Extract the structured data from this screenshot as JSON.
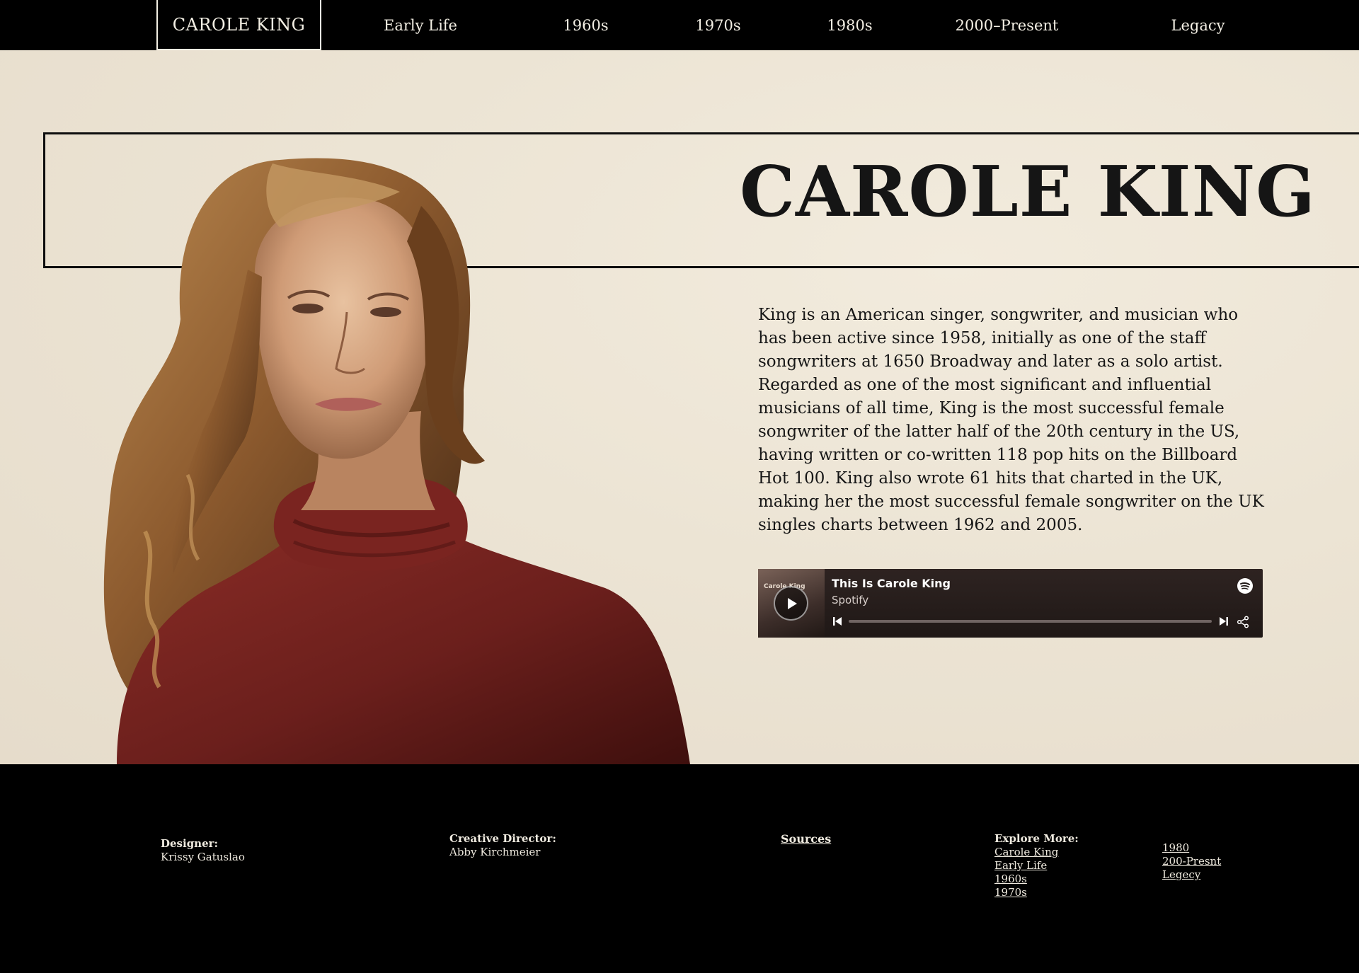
{
  "nav": {
    "brand": "CAROLE KING",
    "items": [
      "Early Life",
      "1960s",
      "1970s",
      "1980s",
      "2000–Present",
      "Legacy"
    ]
  },
  "hero": {
    "title": "CAROLE KING",
    "bio": "King is an American singer, songwriter, and musician who has been active since 1958, initially as one of the staff songwriters at 1650 Broadway and later as a solo artist. Regarded as one of the most significant and influential musicians of all time, King is the most successful female songwriter of the latter half of the 20th century in the US, having written or co-written 118 pop hits on the Billboard Hot 100. King also wrote 61 hits that charted in the UK, making her the most successful female songwriter on the UK singles charts between 1962 and 2005."
  },
  "player": {
    "cover_text": "Carole King",
    "track": "This Is Carole King",
    "artist": "Spotify",
    "progress": 0
  },
  "footer": {
    "designer_label": "Designer:",
    "designer": "Krissy Gatuslao",
    "director_label": "Creative Director:",
    "director": "Abby Kirchmeier",
    "sources": "Sources",
    "explore_label": "Explore More:",
    "explore_links_1": [
      "Carole King",
      "Early Life",
      "1960s",
      "1970s"
    ],
    "explore_links_2": [
      "1980",
      "200-Presnt",
      "Legecy"
    ]
  },
  "colors": {
    "background": "#000000",
    "paper": "#ece4d4",
    "text_light": "#f3efe4",
    "sweater": "#6b1f1c",
    "hair": "#8a5a2c",
    "player_bg": "#2a201e"
  }
}
